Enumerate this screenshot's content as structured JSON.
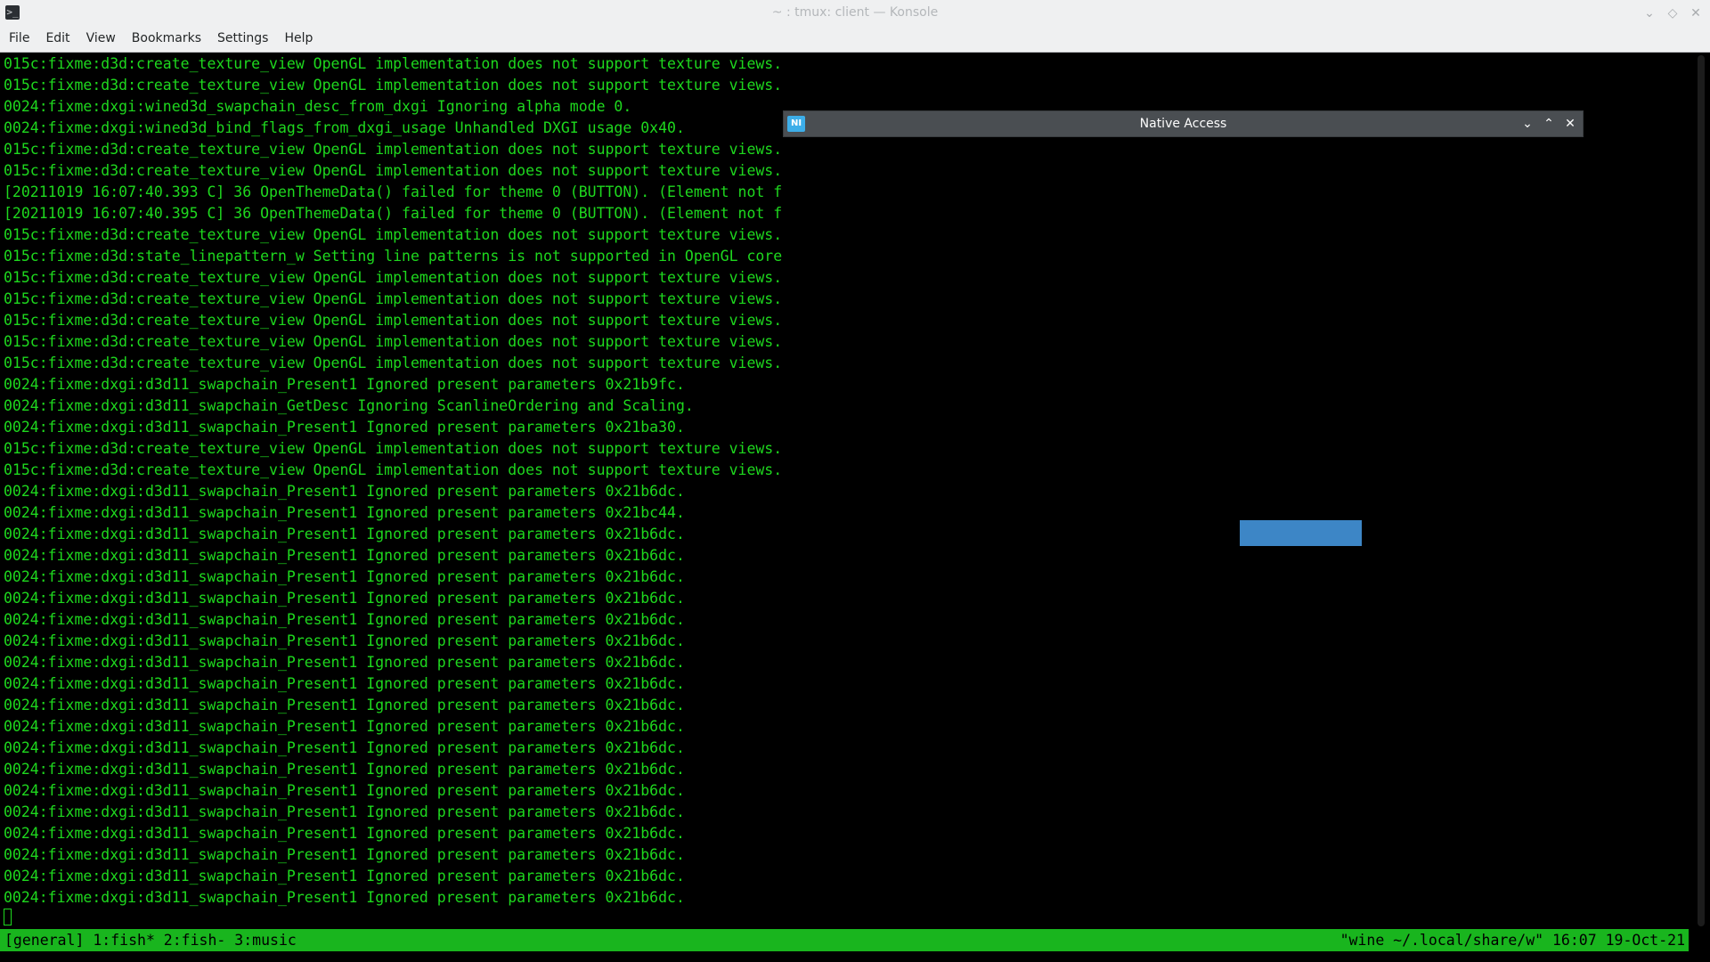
{
  "window": {
    "title": "~ : tmux: client — Konsole",
    "app_icon": ">_"
  },
  "menu": [
    "File",
    "Edit",
    "View",
    "Bookmarks",
    "Settings",
    "Help"
  ],
  "terminal": {
    "lines": [
      "015c:fixme:d3d:create_texture_view OpenGL implementation does not support texture views.",
      "015c:fixme:d3d:create_texture_view OpenGL implementation does not support texture views.",
      "0024:fixme:dxgi:wined3d_swapchain_desc_from_dxgi Ignoring alpha mode 0.",
      "0024:fixme:dxgi:wined3d_bind_flags_from_dxgi_usage Unhandled DXGI usage 0x40.",
      "015c:fixme:d3d:create_texture_view OpenGL implementation does not support texture views.",
      "015c:fixme:d3d:create_texture_view OpenGL implementation does not support texture views.",
      "[20211019 16:07:40.393 C] 36 OpenThemeData() failed for theme 0 (BUTTON). (Element not f",
      "[20211019 16:07:40.395 C] 36 OpenThemeData() failed for theme 0 (BUTTON). (Element not f",
      "015c:fixme:d3d:create_texture_view OpenGL implementation does not support texture views.",
      "015c:fixme:d3d:state_linepattern_w Setting line patterns is not supported in OpenGL core",
      "015c:fixme:d3d:create_texture_view OpenGL implementation does not support texture views.",
      "015c:fixme:d3d:create_texture_view OpenGL implementation does not support texture views.",
      "015c:fixme:d3d:create_texture_view OpenGL implementation does not support texture views.",
      "015c:fixme:d3d:create_texture_view OpenGL implementation does not support texture views.",
      "015c:fixme:d3d:create_texture_view OpenGL implementation does not support texture views.",
      "0024:fixme:dxgi:d3d11_swapchain_Present1 Ignored present parameters 0x21b9fc.",
      "0024:fixme:dxgi:d3d11_swapchain_GetDesc Ignoring ScanlineOrdering and Scaling.",
      "0024:fixme:dxgi:d3d11_swapchain_Present1 Ignored present parameters 0x21ba30.",
      "015c:fixme:d3d:create_texture_view OpenGL implementation does not support texture views.",
      "015c:fixme:d3d:create_texture_view OpenGL implementation does not support texture views.",
      "0024:fixme:dxgi:d3d11_swapchain_Present1 Ignored present parameters 0x21b6dc.",
      "0024:fixme:dxgi:d3d11_swapchain_Present1 Ignored present parameters 0x21bc44.",
      "0024:fixme:dxgi:d3d11_swapchain_Present1 Ignored present parameters 0x21b6dc.",
      "0024:fixme:dxgi:d3d11_swapchain_Present1 Ignored present parameters 0x21b6dc.",
      "0024:fixme:dxgi:d3d11_swapchain_Present1 Ignored present parameters 0x21b6dc.",
      "0024:fixme:dxgi:d3d11_swapchain_Present1 Ignored present parameters 0x21b6dc.",
      "0024:fixme:dxgi:d3d11_swapchain_Present1 Ignored present parameters 0x21b6dc.",
      "0024:fixme:dxgi:d3d11_swapchain_Present1 Ignored present parameters 0x21b6dc.",
      "0024:fixme:dxgi:d3d11_swapchain_Present1 Ignored present parameters 0x21b6dc.",
      "0024:fixme:dxgi:d3d11_swapchain_Present1 Ignored present parameters 0x21b6dc.",
      "0024:fixme:dxgi:d3d11_swapchain_Present1 Ignored present parameters 0x21b6dc.",
      "0024:fixme:dxgi:d3d11_swapchain_Present1 Ignored present parameters 0x21b6dc.",
      "0024:fixme:dxgi:d3d11_swapchain_Present1 Ignored present parameters 0x21b6dc.",
      "0024:fixme:dxgi:d3d11_swapchain_Present1 Ignored present parameters 0x21b6dc.",
      "0024:fixme:dxgi:d3d11_swapchain_Present1 Ignored present parameters 0x21b6dc.",
      "0024:fixme:dxgi:d3d11_swapchain_Present1 Ignored present parameters 0x21b6dc.",
      "0024:fixme:dxgi:d3d11_swapchain_Present1 Ignored present parameters 0x21b6dc.",
      "0024:fixme:dxgi:d3d11_swapchain_Present1 Ignored present parameters 0x21b6dc.",
      "0024:fixme:dxgi:d3d11_swapchain_Present1 Ignored present parameters 0x21b6dc.",
      "0024:fixme:dxgi:d3d11_swapchain_Present1 Ignored present parameters 0x21b6dc."
    ]
  },
  "statusbar": {
    "left": "[general] 1:fish* 2:fish- 3:music",
    "right": "\"wine ~/.local/share/w\" 16:07 19-Oct-21"
  },
  "dialog": {
    "title": "Native Access",
    "icon_text": "NI"
  },
  "colors": {
    "terminal_text": "#1ed81e",
    "status_bg": "#19b51e",
    "dialog_bar": "#4a4e52",
    "dialog_button": "#3d86c6"
  }
}
